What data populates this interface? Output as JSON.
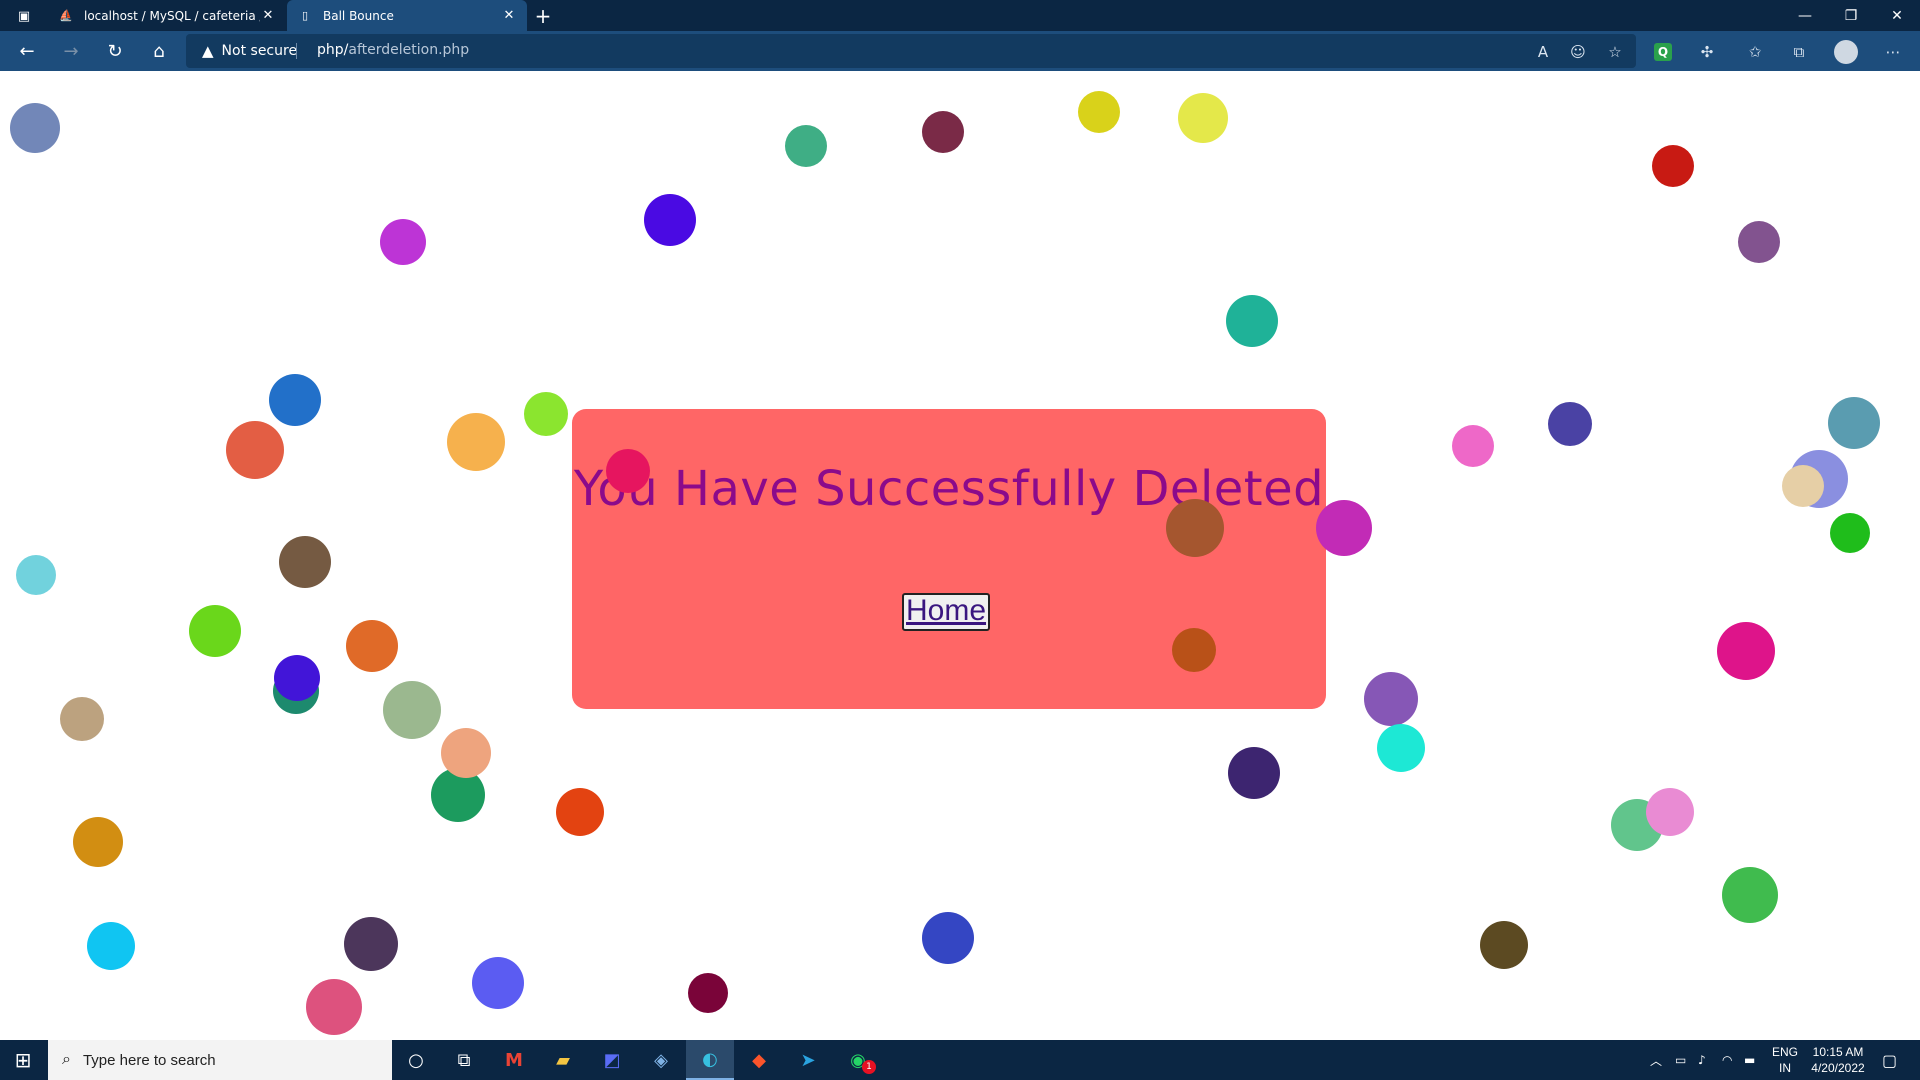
{
  "browser": {
    "tabs": [
      {
        "title": "localhost / MySQL / cafeteria / r",
        "favicon": "phpmyadmin-icon"
      },
      {
        "title": "Ball Bounce",
        "favicon": "page-icon"
      }
    ],
    "security_label": "Not secure",
    "url_host": "php/",
    "url_path": "afterdeletion.php"
  },
  "page": {
    "message": "You Have Successfully Deleted",
    "home_button": "Home",
    "colors": {
      "card": "#ff6363",
      "message": "#8b0a8b"
    }
  },
  "taskbar": {
    "search_placeholder": "Type here to search",
    "language": "ENG",
    "region": "IN",
    "time": "10:15 AM",
    "date": "4/20/2022",
    "whatsapp_badge": "1"
  }
}
